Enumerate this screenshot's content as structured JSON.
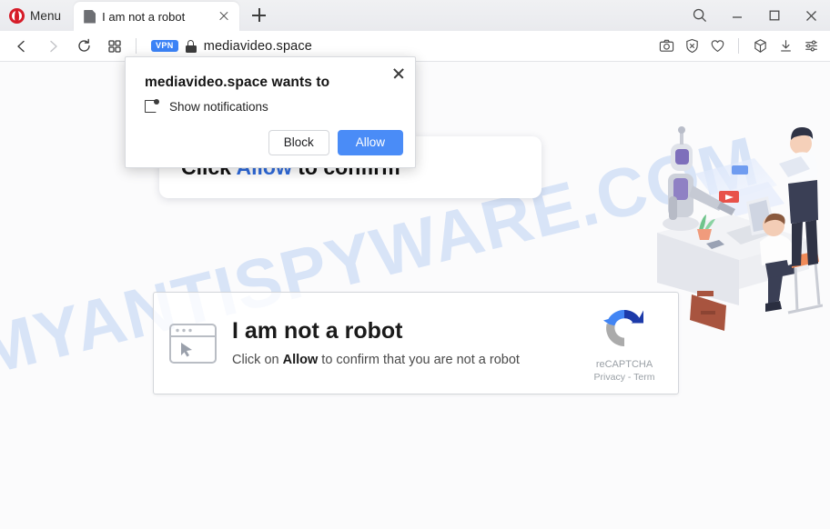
{
  "browser": {
    "menu_label": "Menu",
    "tab": {
      "title": "I am not a robot",
      "favicon": "document-icon",
      "close": "close-icon"
    },
    "new_tab": "+",
    "window_controls": {
      "search": "search-icon",
      "minimize": "minimize-icon",
      "maximize": "maximize-icon",
      "close": "close-icon"
    },
    "nav": {
      "back": "back-arrow-icon",
      "forward": "forward-arrow-icon",
      "reload": "reload-icon",
      "tiles": "speed-dial-icon"
    },
    "omnibox": {
      "vpn_badge": "VPN",
      "lock": "padlock-icon",
      "url": "mediavideo.space"
    },
    "toolbar_icons": [
      "camera-icon",
      "adblock-shield-icon",
      "heart-icon",
      "cube-extensions-icon",
      "download-icon",
      "easy-setup-icon"
    ]
  },
  "dialog": {
    "title": "mediavideo.space wants to",
    "permission": "Show notifications",
    "permission_icon": "notification-badge-icon",
    "close_icon": "close-icon",
    "block_label": "Block",
    "allow_label": "Allow",
    "allow_color": "#4a8cf7"
  },
  "page": {
    "watermark": "MYANTISPYWARE.COM",
    "heading_prefix": "Click ",
    "heading_accent": "Allow",
    "heading_suffix": " to confirm",
    "illustration": "robot-and-office-workers-illustration",
    "captcha": {
      "icon": "browser-window-cursor-icon",
      "title": "I am not a robot",
      "desc_before": "Click on ",
      "desc_bold": "Allow",
      "desc_after": " to confirm that you are not a robot",
      "brand": "reCAPTCHA",
      "legal": "Privacy - Term",
      "logo": "recaptcha-logo-icon"
    }
  }
}
